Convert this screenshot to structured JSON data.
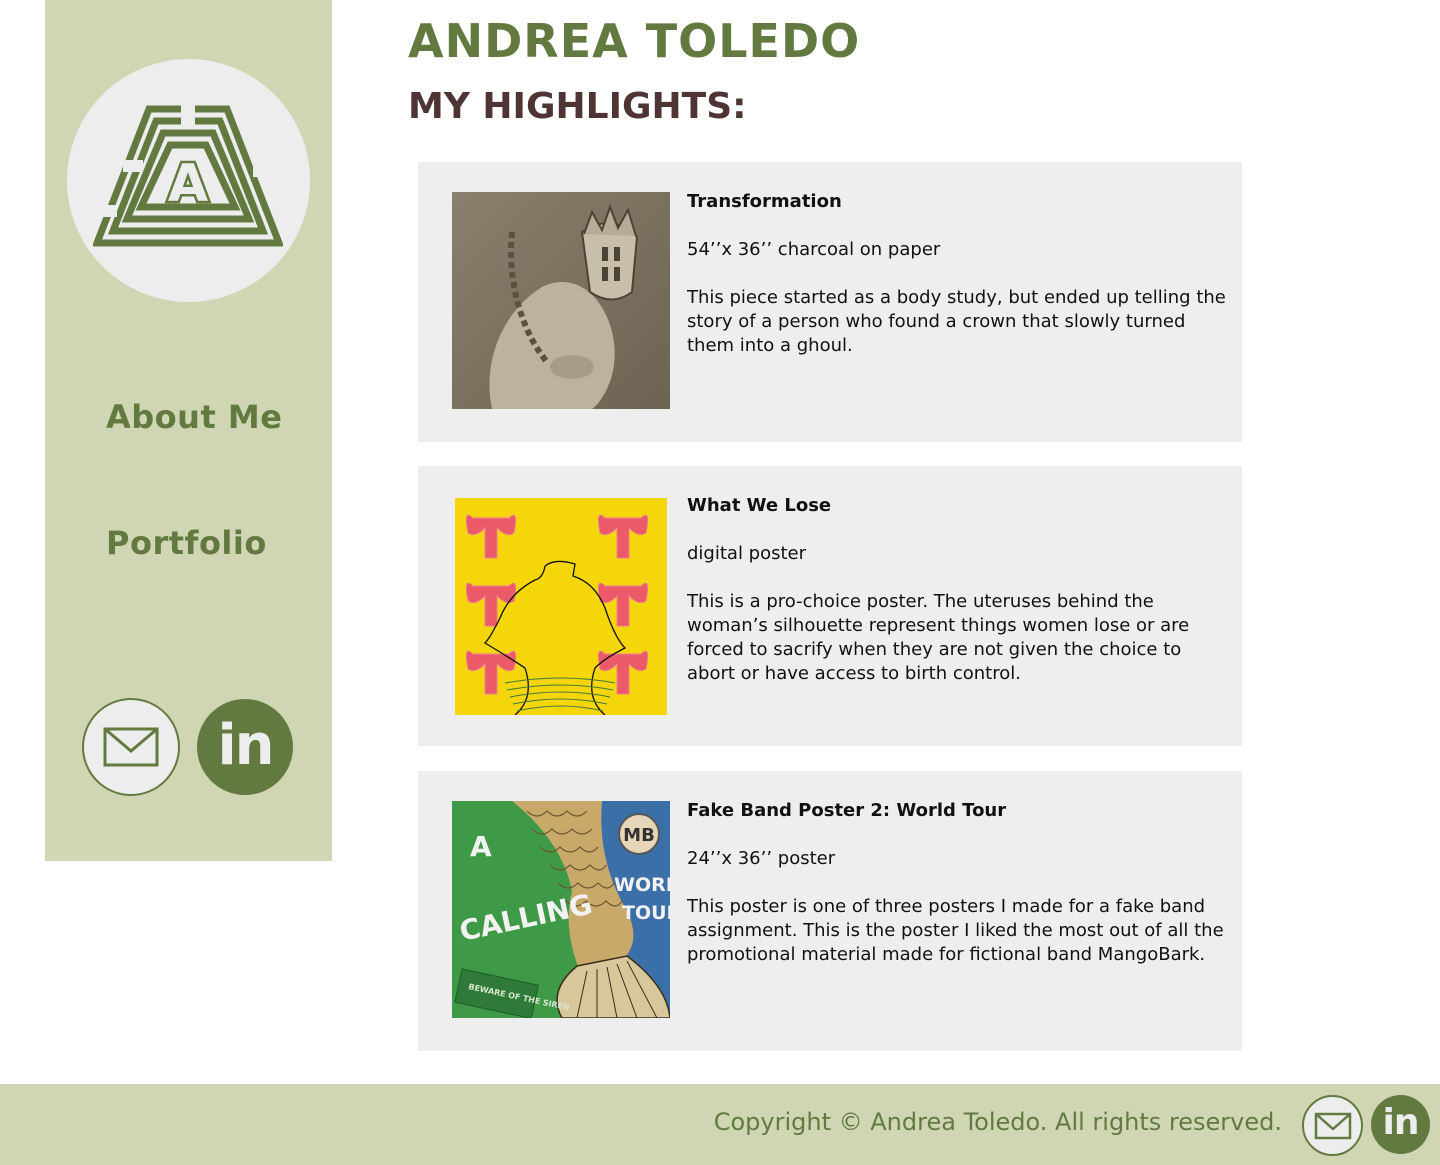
{
  "header": {
    "name": "ANDREA TOLEDO",
    "section_title": "MY HIGHLIGHTS:"
  },
  "sidebar": {
    "logo_icon": "maze-a-logo-icon",
    "nav": [
      {
        "label": "About Me"
      },
      {
        "label": "Portfolio"
      }
    ],
    "social": {
      "mail_icon": "mail-icon",
      "linkedin_text": "in"
    }
  },
  "works": [
    {
      "title": "Transformation",
      "medium": "54’’x 36’’ charcoal on paper",
      "description": "This piece started as a body study, but ended up telling the story of a person who found a crown that slowly turned them into a ghoul."
    },
    {
      "title": "What We Lose",
      "medium": "digital poster",
      "description": "This is a pro-choice poster. The uteruses behind the woman’s silhouette represent things women lose or are forced to sacrify when they are not given the choice to abort or have access to birth control."
    },
    {
      "title": "Fake Band Poster 2: World Tour",
      "medium": "24’’x 36’’ poster",
      "description": "This poster is one of three posters I made for  a fake band assignment. This is the poster I liked the most out of all the promotional material made for fictional band MangoBark.",
      "poster_text": {
        "big_letter": "A",
        "word": "CALLING",
        "tour_line1": "WORLD",
        "tour_line2": "TOUR",
        "sign": "BEWARE OF THE SIREN",
        "badge": "MB"
      }
    }
  ],
  "footer": {
    "copyright": "Copyright © Andrea Toledo. All rights reserved.",
    "linkedin_text": "in"
  },
  "colors": {
    "accent_green": "#627a40",
    "sidebar_bg": "#d0d6b4",
    "heading_brown": "#4f3434",
    "card_bg": "#eeeeee"
  }
}
